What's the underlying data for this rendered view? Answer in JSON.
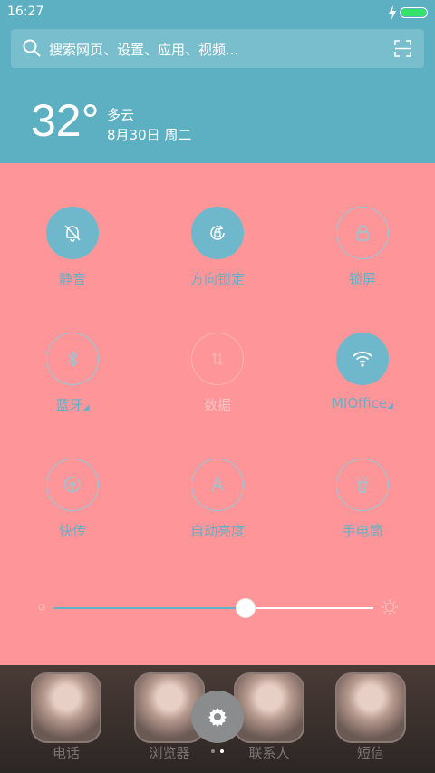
{
  "status": {
    "time": "16:27"
  },
  "search": {
    "placeholder": "搜索网页、设置、应用、视频..."
  },
  "weather": {
    "temperature": "32°",
    "condition": "多云",
    "date": "8月30日  周二"
  },
  "tiles": [
    {
      "label": "静音",
      "state": "on",
      "icon": "bell-off-icon"
    },
    {
      "label": "方向锁定",
      "state": "on",
      "icon": "rotation-lock-icon"
    },
    {
      "label": "锁屏",
      "state": "off",
      "icon": "lock-icon"
    },
    {
      "label": "蓝牙",
      "state": "off",
      "icon": "bluetooth-icon"
    },
    {
      "label": "数据",
      "state": "disabled",
      "icon": "data-arrows-icon"
    },
    {
      "label": "MIOffice",
      "state": "on",
      "icon": "wifi-icon"
    },
    {
      "label": "快传",
      "state": "off",
      "icon": "quick-transfer-icon"
    },
    {
      "label": "自动亮度",
      "state": "off",
      "icon": "auto-brightness-icon"
    },
    {
      "label": "手电筒",
      "state": "off",
      "icon": "flashlight-icon"
    }
  ],
  "brightness": {
    "level": 0.6
  },
  "dock": {
    "apps": [
      "电话",
      "浏览器",
      "联系人",
      "短信"
    ]
  },
  "colors": {
    "accent": "#63b0c7",
    "panel": "#fe9699",
    "header": "#5cb0c2"
  }
}
